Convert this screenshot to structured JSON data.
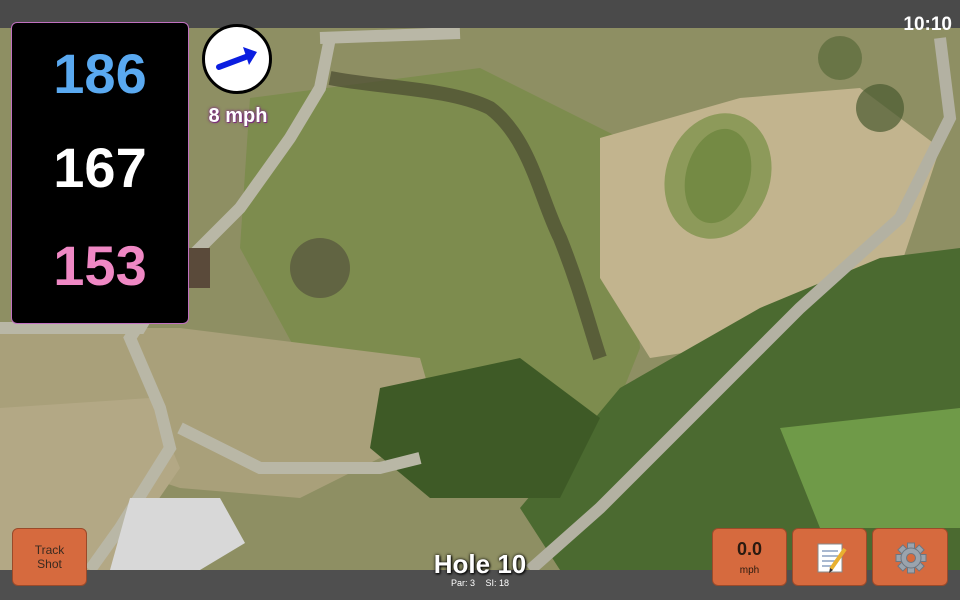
{
  "status_bar": {
    "time": "10:10"
  },
  "distances": {
    "back": "186",
    "middle": "167",
    "front": "153"
  },
  "wind": {
    "speed": "8 mph",
    "direction_icon": "wind-arrow-icon"
  },
  "buttons": {
    "track_shot_line1": "Track",
    "track_shot_line2": "Shot",
    "speed_value": "0.0",
    "speed_unit": "mph",
    "notes_icon": "notepad-icon",
    "settings_icon": "gear-icon"
  },
  "hole": {
    "title": "Hole 10",
    "par": "Par: 3",
    "si": "SI: 18"
  },
  "colors": {
    "back_distance": "#5aa9f0",
    "middle_distance": "#ffffff",
    "front_distance": "#ef88c4",
    "button": "#d66a3e",
    "wind_arrow": "#0b1ee0"
  }
}
